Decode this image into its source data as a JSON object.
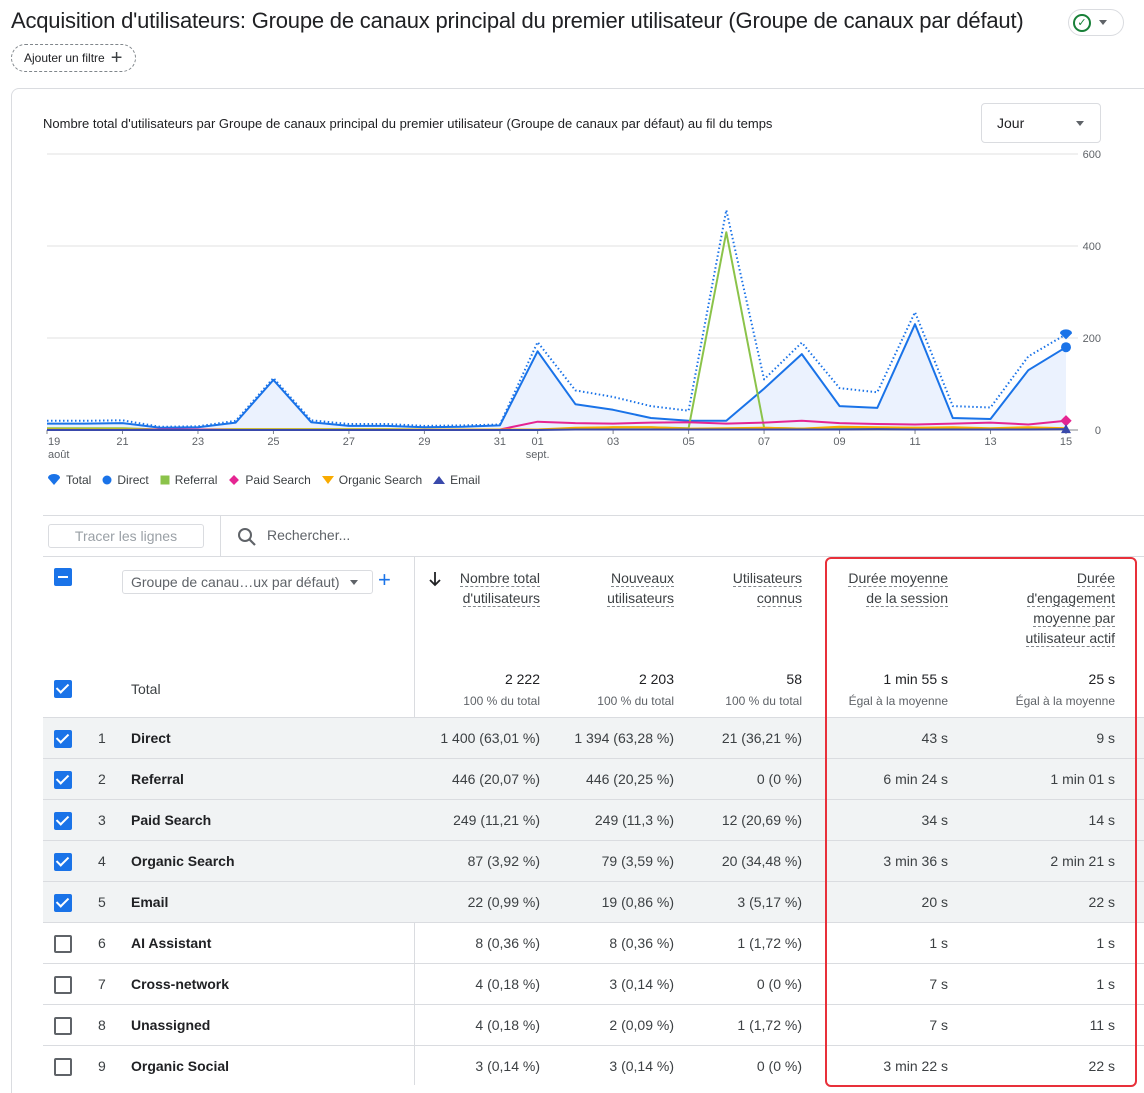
{
  "header": {
    "title": "Acquisition d'utilisateurs: Groupe de canaux principal du premier utilisateur (Groupe de canaux par défaut)",
    "add_filter_label": "Ajouter un filtre"
  },
  "chart_card": {
    "title": "Nombre total d'utilisateurs par Groupe de canaux principal du premier utilisateur (Groupe de canaux par défaut) au fil du temps",
    "granularity": "Jour"
  },
  "chart_data": {
    "type": "line",
    "x": [
      "19 août",
      "20",
      "21",
      "22",
      "23",
      "24",
      "25",
      "26",
      "27",
      "28",
      "29",
      "30",
      "31",
      "01 sept.",
      "02",
      "03",
      "04",
      "05",
      "06",
      "07",
      "08",
      "09",
      "10",
      "11",
      "12",
      "13",
      "14",
      "15"
    ],
    "x_tick_labels": [
      "19",
      "21",
      "23",
      "25",
      "27",
      "29",
      "31",
      "01",
      "03",
      "05",
      "07",
      "09",
      "11",
      "13",
      "15"
    ],
    "x_tick_sublabels": {
      "19": "août",
      "01": "sept."
    },
    "ylim": [
      0,
      600
    ],
    "y_ticks": [
      "600",
      "400",
      "200",
      "0"
    ],
    "series": [
      {
        "name": "Total",
        "color": "#1a73e8",
        "style": "dotted",
        "values": [
          20,
          20,
          21,
          7,
          8,
          20,
          113,
          21,
          13,
          13,
          9,
          10,
          12,
          191,
          86,
          72,
          52,
          42,
          478,
          110,
          190,
          91,
          82,
          256,
          52,
          49,
          160,
          208
        ]
      },
      {
        "name": "Direct",
        "color": "#1a73e8",
        "style": "area",
        "values": [
          14,
          14,
          15,
          5,
          6,
          16,
          109,
          17,
          9,
          9,
          6,
          7,
          10,
          171,
          56,
          44,
          26,
          20,
          20,
          90,
          165,
          52,
          48,
          230,
          26,
          24,
          130,
          180
        ]
      },
      {
        "name": "Referral",
        "color": "#8bc34a",
        "values": [
          4,
          4,
          4,
          1,
          1,
          2,
          2,
          2,
          2,
          2,
          1,
          1,
          1,
          1,
          2,
          6,
          6,
          4,
          430,
          5,
          3,
          4,
          4,
          5,
          3,
          3,
          3,
          3
        ]
      },
      {
        "name": "Paid Search",
        "color": "#e52592",
        "values": [
          1,
          1,
          1,
          1,
          1,
          1,
          1,
          1,
          1,
          1,
          1,
          1,
          1,
          18,
          15,
          14,
          16,
          17,
          14,
          16,
          20,
          15,
          13,
          12,
          14,
          16,
          12,
          20
        ]
      },
      {
        "name": "Organic Search",
        "color": "#f9ab00",
        "values": [
          1,
          1,
          1,
          0,
          0,
          1,
          1,
          1,
          1,
          1,
          1,
          1,
          1,
          1,
          5,
          6,
          6,
          3,
          4,
          5,
          3,
          7,
          6,
          5,
          6,
          4,
          6,
          4
        ]
      },
      {
        "name": "Email",
        "color": "#3949ab",
        "values": [
          0,
          0,
          0,
          0,
          0,
          0,
          0,
          0,
          0,
          0,
          0,
          0,
          0,
          0,
          1,
          1,
          1,
          1,
          1,
          1,
          1,
          1,
          2,
          1,
          1,
          1,
          1,
          2
        ]
      }
    ],
    "legend_position": "bottom-left",
    "grid": true
  },
  "toolbar": {
    "trace_lines_label": "Tracer les lignes",
    "search_placeholder": "Rechercher..."
  },
  "table": {
    "dimension_select": "Groupe de canau…ux par défaut)",
    "columns": [
      {
        "key": "users",
        "label_lines": [
          "Nombre total",
          "d'utilisateurs"
        ],
        "total": "2 222",
        "total_sub": "100 % du total"
      },
      {
        "key": "new_users",
        "label_lines": [
          "Nouveaux",
          "utilisateurs"
        ],
        "total": "2 203",
        "total_sub": "100 % du total"
      },
      {
        "key": "known_users",
        "label_lines": [
          "Utilisateurs",
          "connus"
        ],
        "total": "58",
        "total_sub": "100 % du total"
      },
      {
        "key": "avg_session",
        "label_lines": [
          "Durée moyenne",
          "de la session"
        ],
        "total": "1 min 55 s",
        "total_sub": "Égal à la moyenne"
      },
      {
        "key": "avg_engagement",
        "label_lines": [
          "Durée",
          "d'engagement",
          "moyenne par",
          "utilisateur actif"
        ],
        "total": "25 s",
        "total_sub": "Égal à la moyenne"
      }
    ],
    "total_label": "Total",
    "rows": [
      {
        "n": "1",
        "channel": "Direct",
        "checked": true,
        "users": "1 400 (63,01 %)",
        "new_users": "1 394 (63,28 %)",
        "known_users": "21 (36,21 %)",
        "avg_session": "43 s",
        "avg_engagement": "9 s"
      },
      {
        "n": "2",
        "channel": "Referral",
        "checked": true,
        "users": "446 (20,07 %)",
        "new_users": "446 (20,25 %)",
        "known_users": "0 (0 %)",
        "avg_session": "6 min 24 s",
        "avg_engagement": "1 min 01 s"
      },
      {
        "n": "3",
        "channel": "Paid Search",
        "checked": true,
        "users": "249 (11,21 %)",
        "new_users": "249 (11,3 %)",
        "known_users": "12 (20,69 %)",
        "avg_session": "34 s",
        "avg_engagement": "14 s"
      },
      {
        "n": "4",
        "channel": "Organic Search",
        "checked": true,
        "users": "87 (3,92 %)",
        "new_users": "79 (3,59 %)",
        "known_users": "20 (34,48 %)",
        "avg_session": "3 min 36 s",
        "avg_engagement": "2 min 21 s"
      },
      {
        "n": "5",
        "channel": "Email",
        "checked": true,
        "users": "22 (0,99 %)",
        "new_users": "19 (0,86 %)",
        "known_users": "3 (5,17 %)",
        "avg_session": "20 s",
        "avg_engagement": "22 s"
      },
      {
        "n": "6",
        "channel": "AI Assistant",
        "checked": false,
        "users": "8 (0,36 %)",
        "new_users": "8 (0,36 %)",
        "known_users": "1 (1,72 %)",
        "avg_session": "1 s",
        "avg_engagement": "1 s"
      },
      {
        "n": "7",
        "channel": "Cross-network",
        "checked": false,
        "users": "4 (0,18 %)",
        "new_users": "3 (0,14 %)",
        "known_users": "0 (0 %)",
        "avg_session": "7 s",
        "avg_engagement": "1 s"
      },
      {
        "n": "8",
        "channel": "Unassigned",
        "checked": false,
        "users": "4 (0,18 %)",
        "new_users": "2 (0,09 %)",
        "known_users": "1 (1,72 %)",
        "avg_session": "7 s",
        "avg_engagement": "11 s"
      },
      {
        "n": "9",
        "channel": "Organic Social",
        "checked": false,
        "users": "3 (0,14 %)",
        "new_users": "3 (0,14 %)",
        "known_users": "0 (0 %)",
        "avg_session": "3 min 22 s",
        "avg_engagement": "22 s"
      }
    ]
  }
}
